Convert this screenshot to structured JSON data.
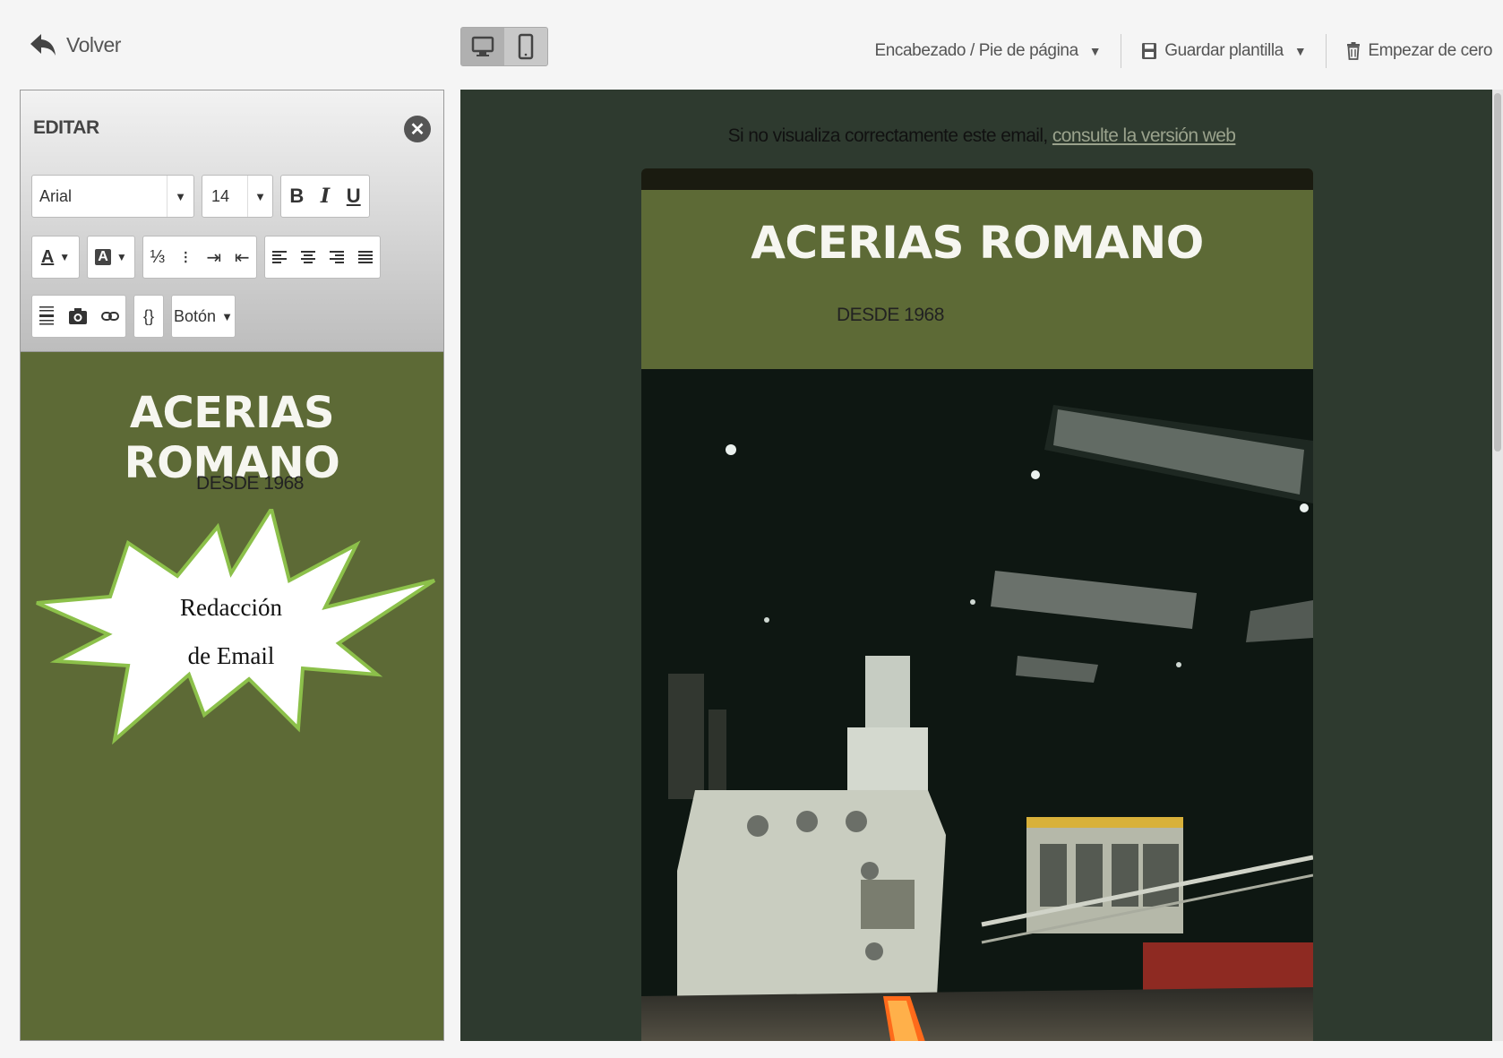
{
  "topbar": {
    "back_label": "Volver",
    "header_footer_label": "Encabezado / Pie de página",
    "save_template_label": "Guardar plantilla",
    "start_over_label": "Empezar de cero",
    "caret": "▼"
  },
  "editor": {
    "title": "EDITAR",
    "font_value": "Arial",
    "size_value": "14",
    "bold": "B",
    "italic": "I",
    "underline": "U",
    "text_color": "A",
    "bg_color": "A",
    "braces": "{}",
    "button_label": "Botón",
    "brand": "ACERIAS ROMANO",
    "since": "DESDE 1968",
    "callout_line1": "Redacción",
    "callout_line2": "de Email"
  },
  "preview": {
    "web_note_prefix": "Si no visualiza correctamente este email,",
    "web_note_link": "consulte la versión web",
    "brand": "ACERIAS ROMANO",
    "since": "DESDE 1968"
  },
  "colors": {
    "brand_green": "#5d6a36",
    "preview_bg": "#2e3a2f",
    "burst_outline": "#8cc04a"
  }
}
